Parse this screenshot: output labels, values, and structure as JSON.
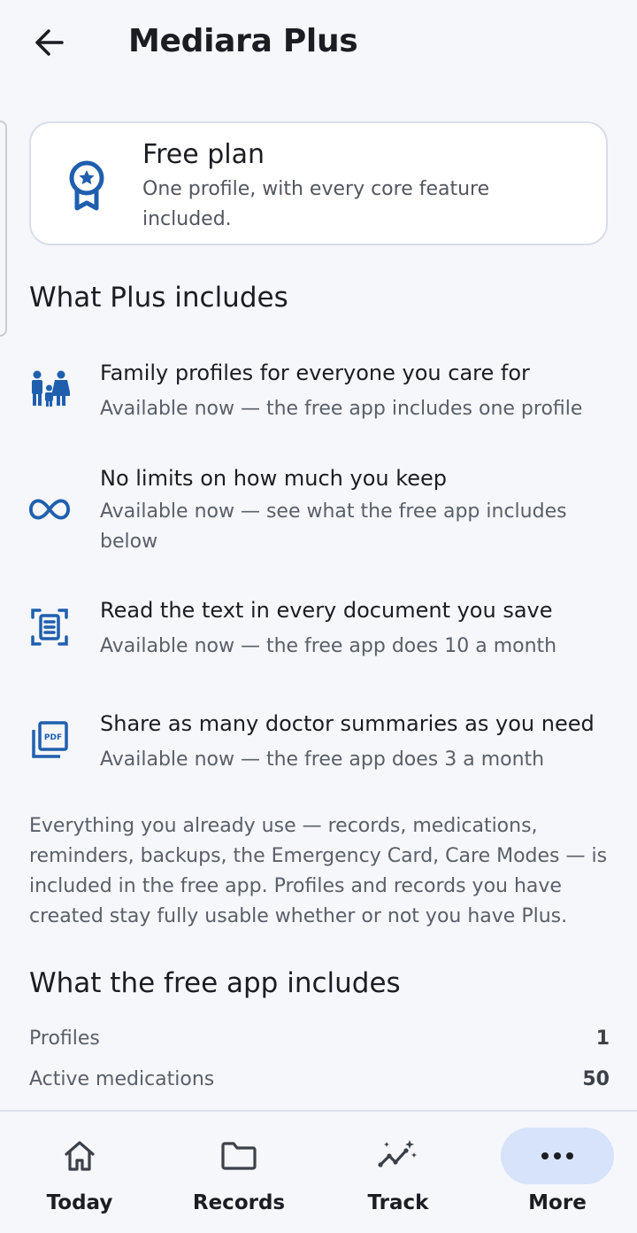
{
  "header": {
    "title": "Mediara Plus",
    "back_icon": "arrow-left-icon"
  },
  "plan_card": {
    "icon": "award-badge-icon",
    "title": "Free plan",
    "subtitle": "One profile, with every core feature included."
  },
  "plus_section": {
    "title": "What Plus includes",
    "features": [
      {
        "icon": "family-icon",
        "title": "Family profiles for everyone you care for",
        "subtitle": "Available now — the free app includes one profile"
      },
      {
        "icon": "infinity-icon",
        "title": "No limits on how much you keep",
        "subtitle": "Available now — see what the free app includes below"
      },
      {
        "icon": "document-scan-icon",
        "title": "Read the text in every document you save",
        "subtitle": "Available now — the free app does 10 a month"
      },
      {
        "icon": "pdf-icon",
        "title": "Share as many doctor summaries as you need",
        "subtitle": "Available now — the free app does 3 a month"
      }
    ]
  },
  "note": "Everything you already use — records, medications, reminders, backups, the Emergency Card, Care Modes — is included in the free app. Profiles and records you have created stay fully usable whether or not you have Plus.",
  "free_section": {
    "title": "What the free app includes",
    "limits": [
      {
        "label": "Profiles",
        "value": "1"
      },
      {
        "label": "Active medications",
        "value": "50"
      }
    ]
  },
  "bottom_nav": {
    "items": [
      {
        "label": "Today",
        "icon": "home-icon",
        "active": false
      },
      {
        "label": "Records",
        "icon": "folder-icon",
        "active": false
      },
      {
        "label": "Track",
        "icon": "sparkle-trend-icon",
        "active": false
      },
      {
        "label": "More",
        "icon": "more-dots-icon",
        "active": true
      }
    ]
  },
  "colors": {
    "accent": "#1f5fae",
    "background": "#f5f7fb",
    "active_pill": "#d7e3fa"
  }
}
